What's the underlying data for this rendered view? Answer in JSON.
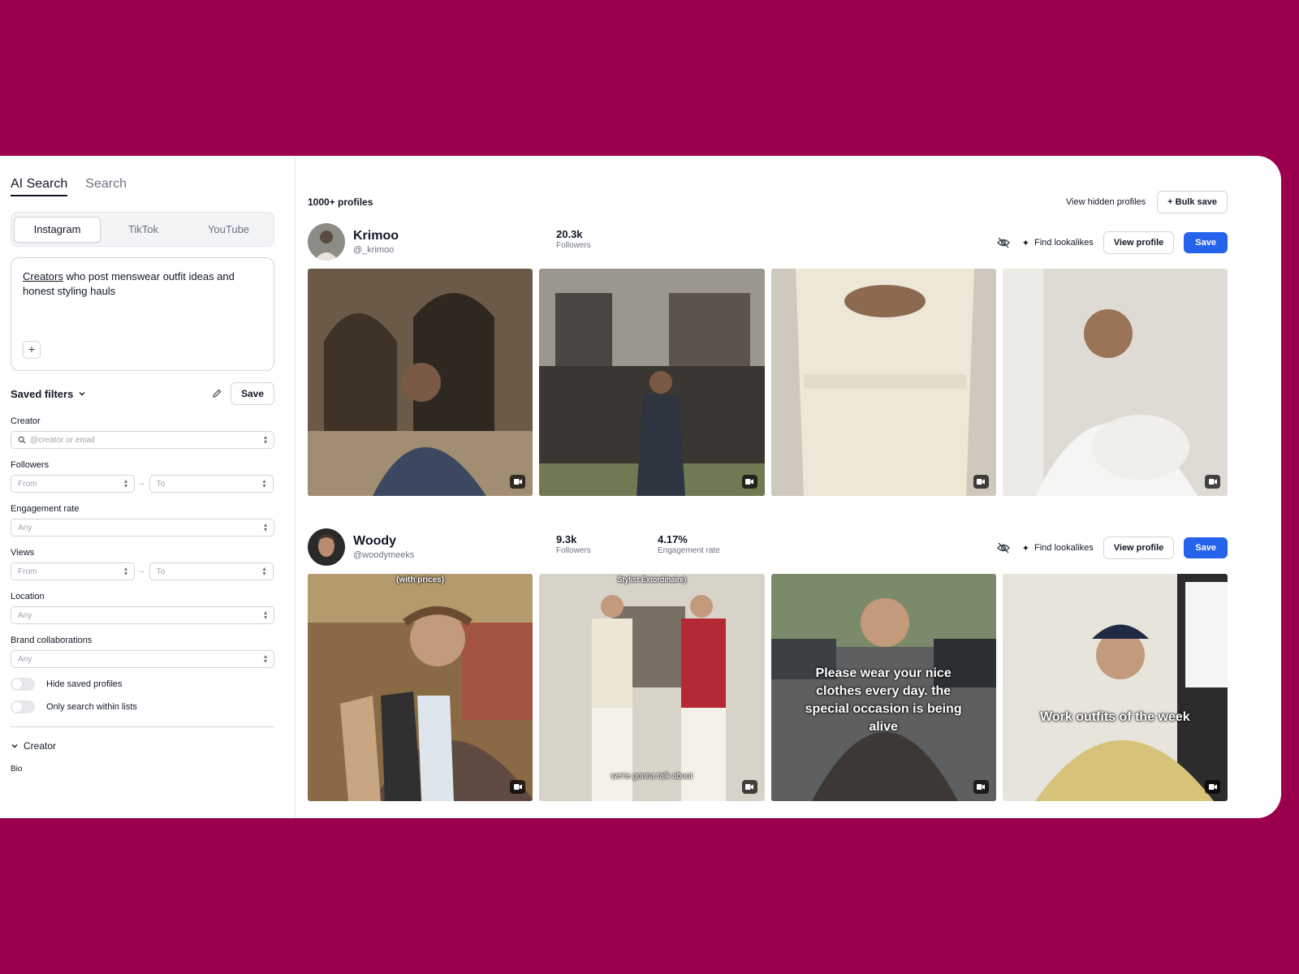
{
  "sidebar": {
    "tabs": [
      "AI Search",
      "Search"
    ],
    "platforms": [
      "Instagram",
      "TikTok",
      "YouTube"
    ],
    "prompt": {
      "underlined": "Creators",
      "rest": " who post menswear outfit ideas and honest styling hauls",
      "add_symbol": "+"
    },
    "saved_filters_label": "Saved filters",
    "save_label": "Save",
    "creator_label": "Creator",
    "creator_placeholder": "@creator or email",
    "followers_label": "Followers",
    "from_placeholder": "From",
    "to_placeholder": "To",
    "engagement_label": "Engagement rate",
    "any_placeholder": "Any",
    "views_label": "Views",
    "location_label": "Location",
    "brand_label": "Brand collaborations",
    "toggles": [
      "Hide saved profiles",
      "Only search within lists"
    ],
    "section_title": "Creator",
    "bio_label": "Bio"
  },
  "main": {
    "count": "1000+ profiles",
    "view_hidden": "View hidden profiles",
    "bulk_save": "+ Bulk save",
    "find_lookalikes": "Find lookalikes",
    "view_profile": "View profile",
    "save": "Save",
    "profiles": [
      {
        "name": "Krimoo",
        "handle": "@_krimoo",
        "followers": "20.3k",
        "followers_label": "Followers",
        "captions": [
          "",
          "",
          "",
          ""
        ]
      },
      {
        "name": "Woody",
        "handle": "@woodymeeks",
        "followers": "9.3k",
        "followers_label": "Followers",
        "engagement": "4.17%",
        "engagement_label": "Engagement rate",
        "captions": [
          "(with prices)",
          "Stylist Extordinaire)",
          "Please wear your nice clothes every day. the special occasion is being alive",
          "Work outfits of the week"
        ],
        "bottom_captions": [
          "",
          "we're gonna talk about",
          "",
          ""
        ]
      }
    ]
  },
  "colors": {
    "background": "#9b004c",
    "primary": "#2563eb"
  }
}
